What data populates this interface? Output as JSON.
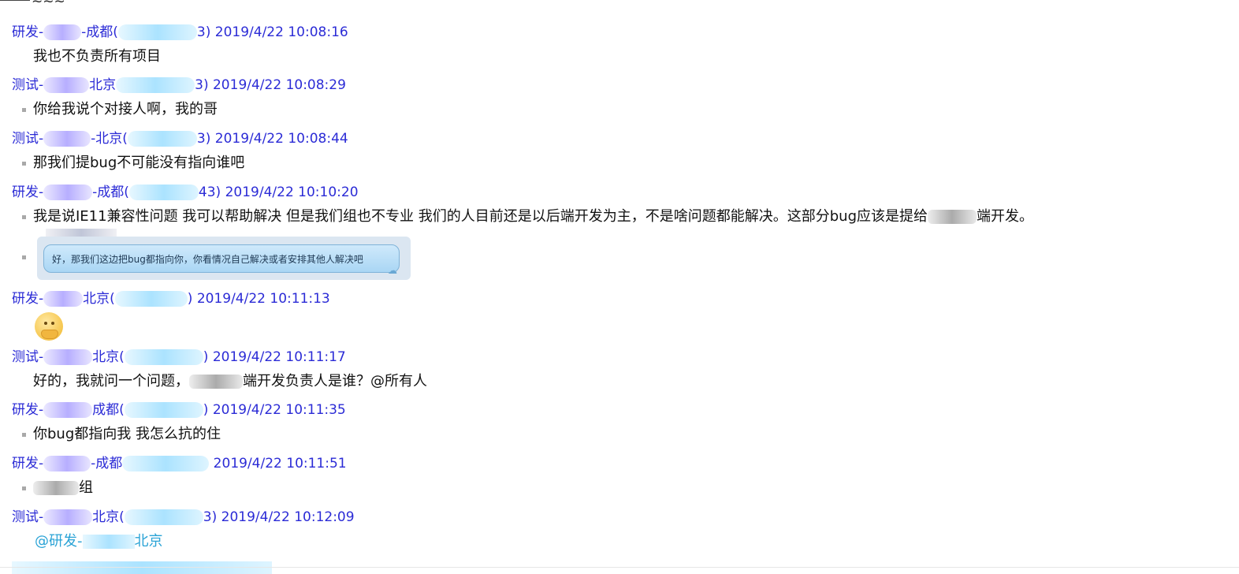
{
  "top_fragment": "~~~",
  "messages": [
    {
      "header_pre": "研发-",
      "header_mid": "-成都(",
      "header_post": "3) 2019/4/22 10:08:16",
      "text": "我也不负责所有项目",
      "bullet": false
    },
    {
      "header_pre": "测试-",
      "header_mid": "北京",
      "header_post": "3) 2019/4/22 10:08:29",
      "text": "你给我说个对接人啊，我的哥",
      "bullet": true
    },
    {
      "header_pre": "测试-",
      "header_mid": "-北京(",
      "header_post": "3) 2019/4/22 10:08:44",
      "text": "那我们提bug不可能没有指向谁吧",
      "bullet": true
    },
    {
      "header_pre": "研发-",
      "header_mid": "-成都(",
      "header_post": "43) 2019/4/22 10:10:20",
      "text": "我是说IE11兼容性问题  我可以帮助解决  但是我们组也不专业  我们的人目前还是以后端开发为主，不是啥问题都能解决。这部分bug应该是提给",
      "text_tail": "端开发。",
      "bullet": true
    },
    {
      "header_pre": "研发-",
      "header_mid": "北京(",
      "header_post": ") 2019/4/22 10:11:13",
      "text": "",
      "bullet": false
    },
    {
      "header_pre": "测试-",
      "header_mid": "北京(",
      "header_post": ") 2019/4/22 10:11:17",
      "text": "好的，我就问一个问题，",
      "text_tail": "端开发负责人是谁？@所有人",
      "bullet": false
    },
    {
      "header_pre": "研发-",
      "header_mid": "成都(",
      "header_post": ") 2019/4/22 10:11:35",
      "text": "你bug都指向我  我怎么抗的住",
      "bullet": true
    },
    {
      "header_pre": "研发-",
      "header_mid": "-成都",
      "header_post": " 2019/4/22 10:11:51",
      "text": "",
      "text_tail": "组",
      "bullet": true
    },
    {
      "header_pre": "测试-",
      "header_mid": "北京(",
      "header_post": "3) 2019/4/22 10:12:09",
      "text": "@研发-",
      "text_tail": "北京",
      "bullet": false
    }
  ],
  "image_bubble": {
    "text": "好，那我们这边把bug都指向你，你看情况自己解决或者安排其他人解决吧"
  },
  "colors": {
    "header": "#2b2bd6",
    "mention": "#2aa3d6",
    "text": "#111111"
  }
}
